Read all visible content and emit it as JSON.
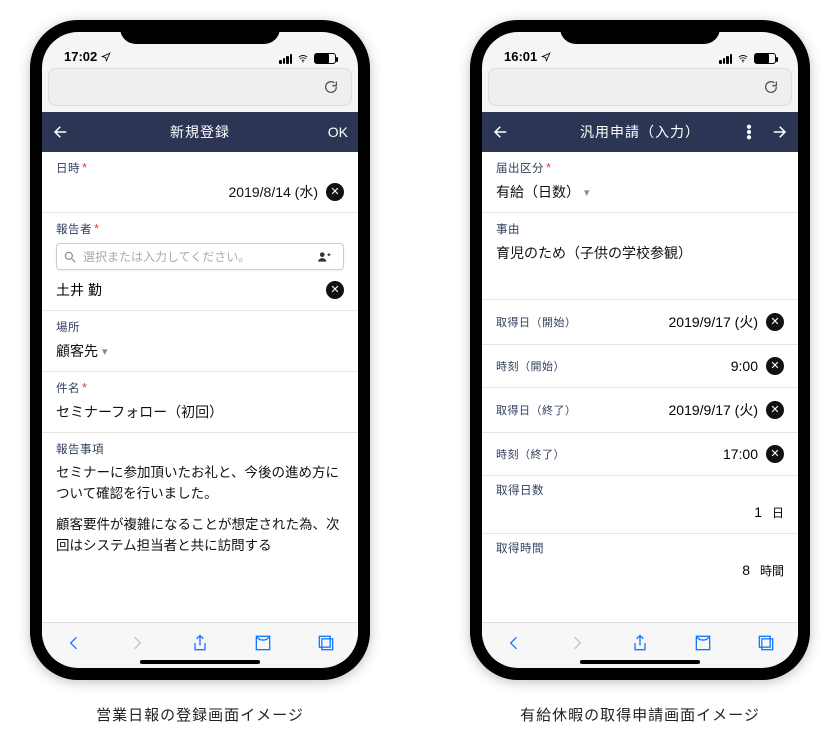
{
  "captions": {
    "left": "営業日報の登録画面イメージ",
    "right": "有給休暇の取得申請画面イメージ"
  },
  "phone1": {
    "status_time": "17:02",
    "header": {
      "title": "新規登録",
      "ok": "OK"
    },
    "date": {
      "label": "日時",
      "value": "2019/8/14 (水)"
    },
    "reporter": {
      "label": "報告者",
      "placeholder": "選択または入力してください。",
      "selected": "土井 勤"
    },
    "place": {
      "label": "場所",
      "value": "顧客先"
    },
    "subject": {
      "label": "件名",
      "value": "セミナーフォロー（初回）"
    },
    "report": {
      "label": "報告事項",
      "p1": "セミナーに参加頂いたお礼と、今後の進め方について確認を行いました。",
      "p2": "顧客要件が複雑になることが想定された為、次回はシステム担当者と共に訪問する"
    }
  },
  "phone2": {
    "status_time": "16:01",
    "header": {
      "title": "汎用申請（入力）"
    },
    "category": {
      "label": "届出区分",
      "value": "有給（日数）"
    },
    "reason": {
      "label": "事由",
      "value": "育児のため（子供の学校参観）"
    },
    "start_date": {
      "label": "取得日（開始）",
      "value": "2019/9/17 (火)"
    },
    "start_time": {
      "label": "時刻（開始）",
      "value": "9:00"
    },
    "end_date": {
      "label": "取得日（終了）",
      "value": "2019/9/17 (火)"
    },
    "end_time": {
      "label": "時刻（終了）",
      "value": "17:00"
    },
    "days": {
      "label": "取得日数",
      "value": "1",
      "unit": "日"
    },
    "hours": {
      "label": "取得時間",
      "value": "8",
      "unit": "時間"
    }
  }
}
